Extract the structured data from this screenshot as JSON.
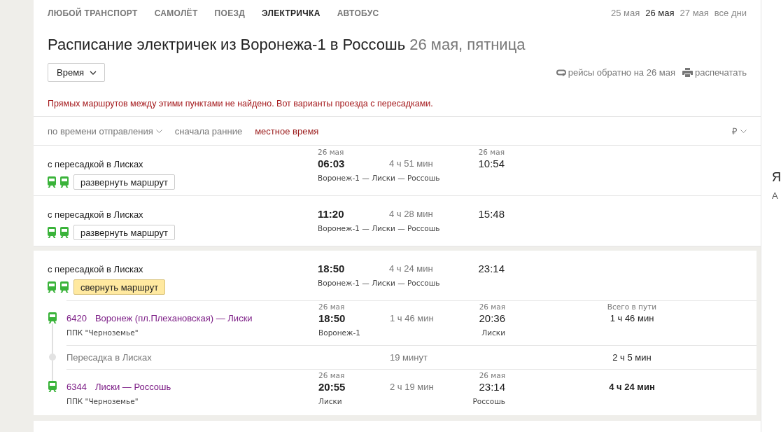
{
  "transport_tabs": [
    {
      "label": "ЛЮБОЙ ТРАНСПОРТ",
      "selected": false
    },
    {
      "label": "САМОЛЁТ",
      "selected": false
    },
    {
      "label": "ПОЕЗД",
      "selected": false
    },
    {
      "label": "ЭЛЕКТРИЧКА",
      "selected": true
    },
    {
      "label": "АВТОБУС",
      "selected": false
    }
  ],
  "days": [
    {
      "label": "25 мая",
      "selected": false
    },
    {
      "label": "26 мая",
      "selected": true
    },
    {
      "label": "27 мая",
      "selected": false
    },
    {
      "label": "все дни",
      "selected": false
    }
  ],
  "title": {
    "main": "Расписание электричек из Воронежа-1 в Россошь",
    "date": "26 мая, пятница"
  },
  "sort_dropdown": {
    "label": "Время"
  },
  "actions": [
    {
      "kind": "return",
      "label": "рейсы обратно на 26 мая"
    },
    {
      "kind": "print",
      "label": "распечатать"
    }
  ],
  "notice": "Прямых маршрутов между этими пунктами не найдено. Вот варианты проезда с пересадками.",
  "sort_bar": {
    "order": "по времени отправления",
    "direction": "сначала ранние",
    "timezone": "местное время",
    "currency": "₽"
  },
  "routes": [
    {
      "transfer": "с пересадкой в Лисках",
      "toggle": "развернуть маршрут",
      "expanded": false,
      "departure_date": "26 мая",
      "departure": "06:03",
      "duration": "4 ч 51 мин",
      "stations": "Воронеж-1 — Лиски — Россошь",
      "arrival_date": "26 мая",
      "arrival": "10:54"
    },
    {
      "transfer": "с пересадкой в Лисках",
      "toggle": "развернуть маршрут",
      "expanded": false,
      "departure": "11:20",
      "duration": "4 ч 28 мин",
      "stations": "Воронеж-1 — Лиски — Россошь",
      "arrival": "15:48"
    },
    {
      "transfer": "с пересадкой в Лисках",
      "toggle": "свернуть маршрут",
      "expanded": true,
      "departure": "18:50",
      "duration": "4 ч 24 мин",
      "stations": "Воронеж-1 — Лиски — Россошь",
      "arrival": "23:14",
      "segments": [
        {
          "kind": "train",
          "number": "6420",
          "name": "Воронеж (пл.Плехановская) — Лиски",
          "carrier": "ППК \"Черноземье\"",
          "departure_date": "26 мая",
          "departure": "18:50",
          "from": "Воронеж-1",
          "duration": "1 ч 46 мин",
          "arrival_date": "26 мая",
          "arrival": "20:36",
          "to": "Лиски",
          "total_label": "Всего в пути",
          "total": "1 ч 46 мин",
          "final": false
        },
        {
          "kind": "transfer",
          "label": "Пересадка в Лисках",
          "duration": "19 минут",
          "total": "2 ч 5 мин",
          "final": false
        },
        {
          "kind": "train",
          "number": "6344",
          "name": "Лиски — Россошь",
          "carrier": "ППК \"Черноземье\"",
          "departure_date": "26 мая",
          "departure": "20:55",
          "from": "Лиски",
          "duration": "2 ч 19 мин",
          "arrival_date": "26 мая",
          "arrival": "23:14",
          "to": "Россошь",
          "total": "4 ч 24 мин",
          "final": true
        }
      ]
    }
  ],
  "side_panel": {
    "title": "Я",
    "text": "А"
  }
}
